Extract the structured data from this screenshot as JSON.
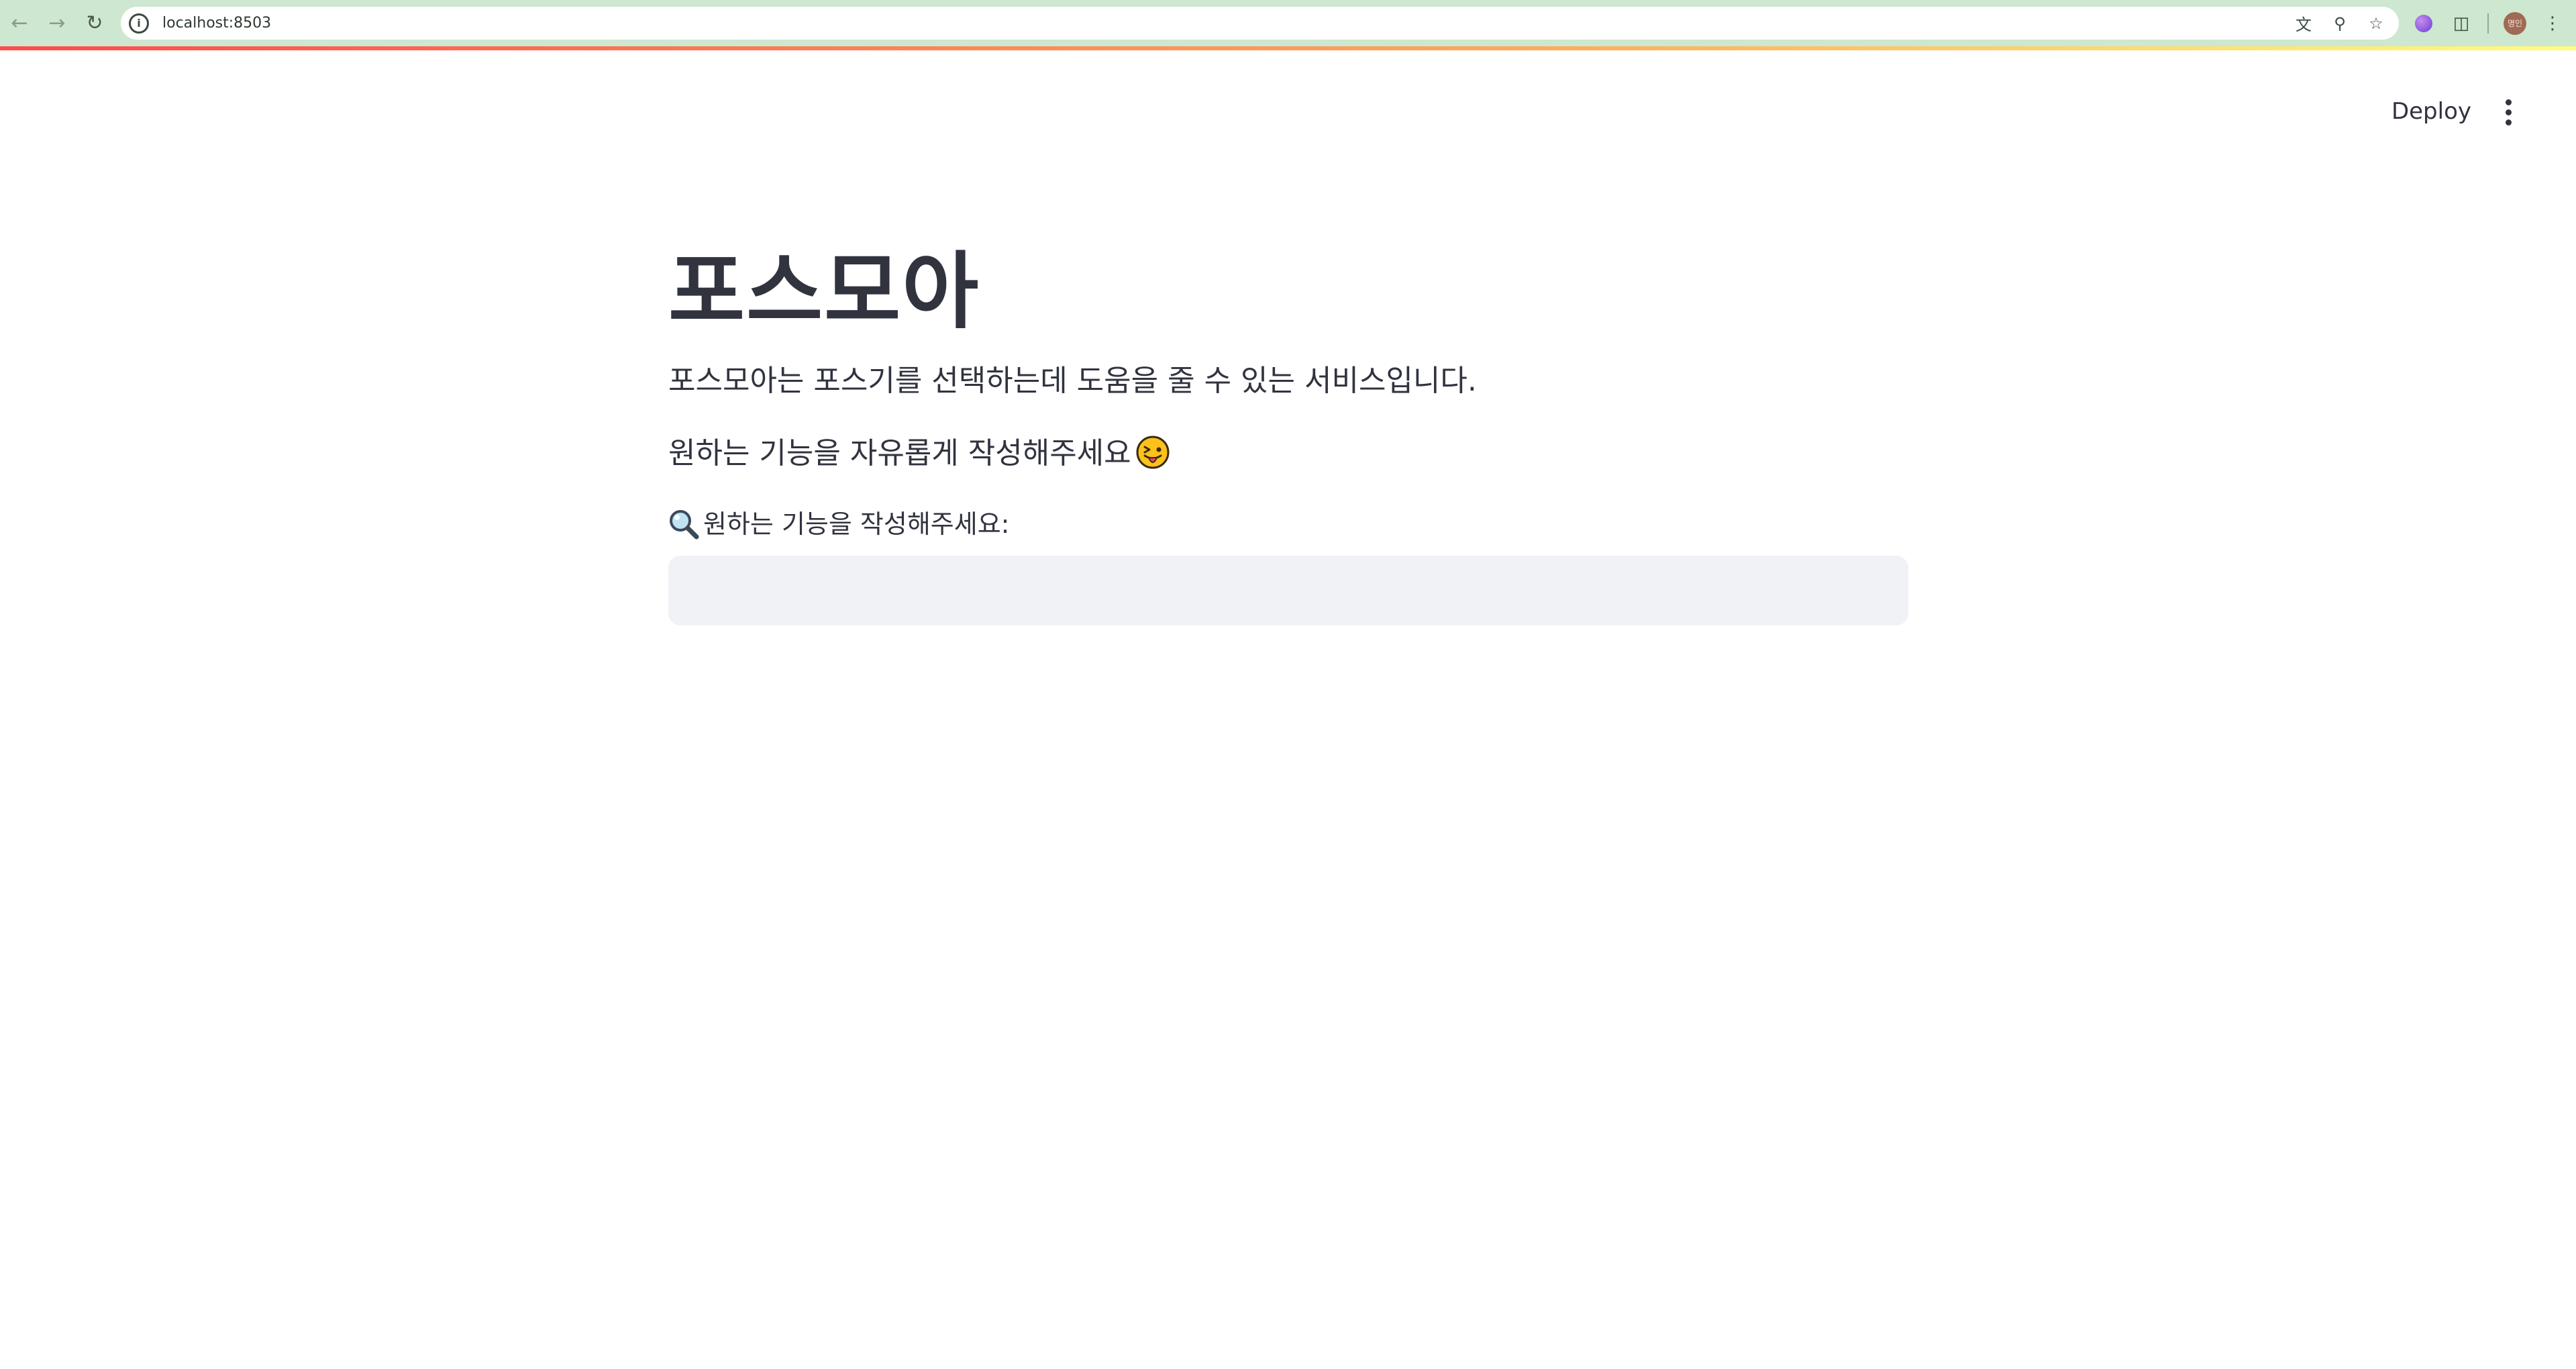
{
  "browser": {
    "url": "localhost:8503",
    "icons": {
      "back": "arrow-left-icon",
      "forward": "arrow-right-icon",
      "reload": "reload-icon",
      "site_info": "info-icon",
      "translate": "translate-icon",
      "zoom": "zoom-icon",
      "bookmark": "star-icon",
      "extension": "gem-extension-icon",
      "extensions": "puzzle-icon",
      "menu": "kebab-menu-icon"
    },
    "profile_initials": "명인"
  },
  "header": {
    "deploy_label": "Deploy",
    "menu_icon": "kebab-menu-icon"
  },
  "main": {
    "title": "포스모아",
    "intro": "포스모아는 포스기를 선택하는데 도움을 줄 수 있는 서비스입니다.",
    "prompt": "원하는 기능을 자유롭게 작성해주세요",
    "prompt_emoji": "tongue-out-face-icon",
    "input_label": "원하는 기능을 작성해주세요:",
    "input_label_icon": "magnifier-icon",
    "input_value": "",
    "input_placeholder": ""
  },
  "colors": {
    "chrome_bg": "#cde7d0",
    "text": "#31333f",
    "input_bg": "#f0f2f6",
    "accent_red": "#ff4b4b"
  }
}
